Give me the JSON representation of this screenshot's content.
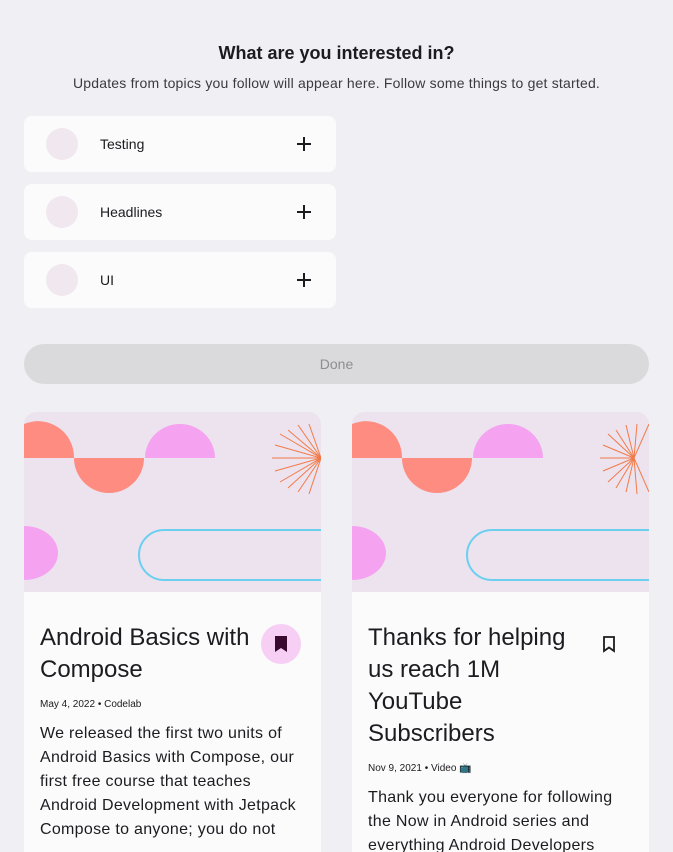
{
  "header": {
    "title": "What are you interested in?",
    "subtitle": "Updates from topics you follow will appear here. Follow some things to get started."
  },
  "topics": [
    {
      "label": "Testing",
      "icon": "add-icon"
    },
    {
      "label": "Headlines",
      "icon": "add-icon"
    },
    {
      "label": "UI",
      "icon": "add-icon"
    }
  ],
  "done_label": "Done",
  "cards": [
    {
      "title": "Android Basics with Compose",
      "meta": "May 4, 2022 • Codelab",
      "description": "We released the first two units of Android Basics with Compose, our first free course that teaches Android Development with Jetpack Compose to anyone; you do not",
      "bookmarked": true,
      "icon": "bookmark-filled-icon"
    },
    {
      "title": "Thanks for helping us reach 1M YouTube Subscribers",
      "meta": "Nov 9, 2021 • Video 📺",
      "description": "Thank you everyone for following the Now in Android series and everything Android Developers",
      "bookmarked": false,
      "icon": "bookmark-outline-icon"
    }
  ],
  "colors": {
    "background": "#f0eff3",
    "card": "#fbfbfb",
    "done_disabled": "#dadadd",
    "bookmark_active_bg": "#f7cff5",
    "bookmark_active_fg": "#3a0a30",
    "art_bg": "#ece3ee",
    "art_pink": "#f5a3f0",
    "art_coral": "#ff8c80",
    "art_blue": "#6ccff0",
    "art_orange": "#f27a48"
  }
}
